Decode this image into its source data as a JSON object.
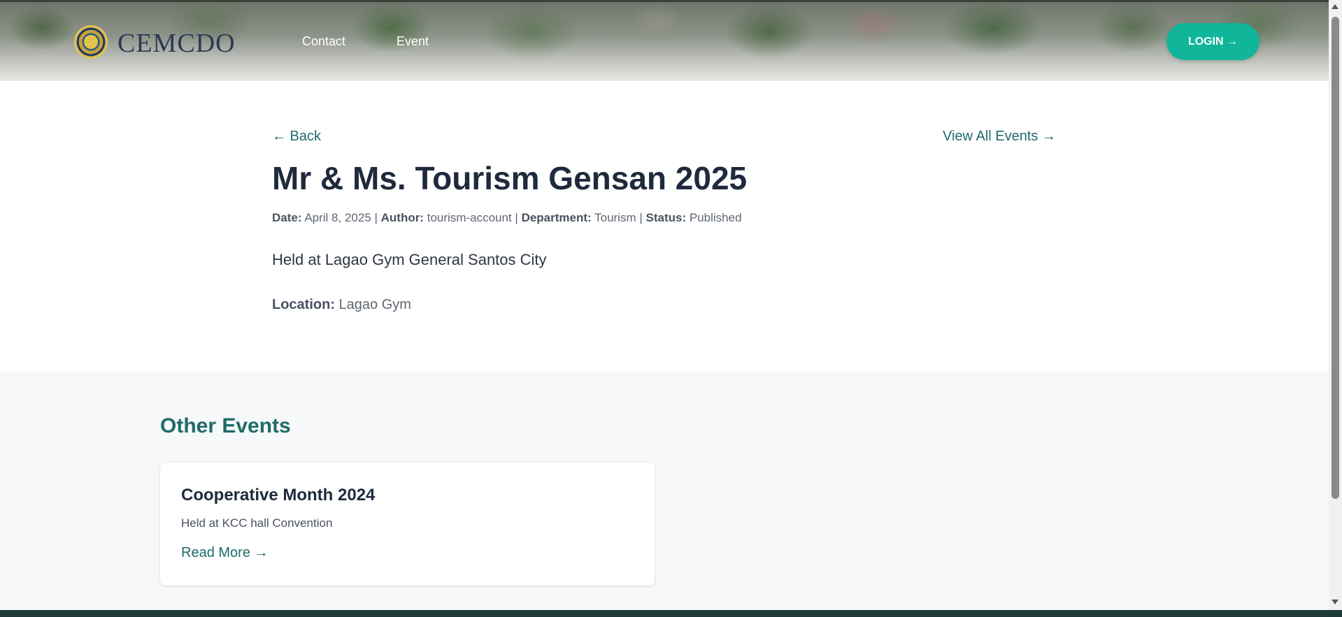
{
  "header": {
    "brand": "CEMCDO",
    "nav": [
      {
        "label": "Contact"
      },
      {
        "label": "Event"
      }
    ],
    "login_label": "LOGIN →"
  },
  "event": {
    "back_label": "← Back",
    "view_all_label": "View All Events →",
    "title": "Mr & Ms. Tourism Gensan 2025",
    "meta": {
      "date_label": "Date:",
      "date": "April 8, 2025",
      "author_label": "Author:",
      "author": "tourism-account",
      "department_label": "Department:",
      "department": "Tourism",
      "status_label": "Status:",
      "status": "Published",
      "separator": " | "
    },
    "description": "Held at Lagao Gym General Santos City",
    "location_label": "Location:",
    "location": "Lagao Gym"
  },
  "other_events": {
    "heading": "Other Events",
    "cards": [
      {
        "title": "Cooperative Month 2024",
        "description": "Held at KCC hall Convention",
        "link_label": "Read More →"
      }
    ]
  },
  "colors": {
    "accent": "#1f6b68",
    "login_button": "#10b59a",
    "title_text": "#1f2a3c"
  }
}
